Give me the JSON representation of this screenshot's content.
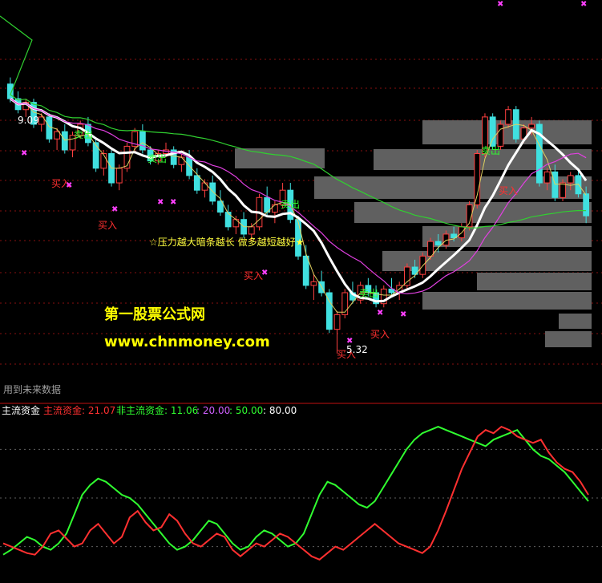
{
  "main": {
    "high_label": "9.09",
    "low_label": "5.32",
    "top_hint": "用到未来数据",
    "signals": [
      {
        "text": "卖出",
        "kind": "sell"
      },
      {
        "text": "卖出",
        "kind": "sell"
      },
      {
        "text": "卖出",
        "kind": "sell"
      },
      {
        "text": "卖出",
        "kind": "sell"
      },
      {
        "text": "卖出",
        "kind": "sell"
      },
      {
        "text": "买入",
        "kind": "buy"
      },
      {
        "text": "买入",
        "kind": "buy"
      },
      {
        "text": "买入",
        "kind": "buy"
      },
      {
        "text": "买入",
        "kind": "buy"
      },
      {
        "text": "买入",
        "kind": "buy"
      },
      {
        "text": "买入",
        "kind": "buy"
      }
    ],
    "annotation": "☆压力越大暗条越长 做多越短越好★",
    "watermark_cn": "第一股票公式网",
    "watermark_url": "www.chnmoney.com"
  },
  "sub": {
    "title": "主流资金",
    "legend": [
      {
        "text": "主流资金: 21.07",
        "color": "#ff3030"
      },
      {
        "text": "非主流资金: 11.06",
        "color": "#30ff30"
      },
      {
        "text": ": 20.00",
        "color": "#d060ff"
      },
      {
        "text": ": 50.00",
        "color": "#30ff30"
      },
      {
        "text": ": 80.00",
        "color": "#ffffff"
      }
    ]
  },
  "colors": {
    "up": "#ff4040",
    "down": "#40e0e0",
    "ma_white": "#ffffff",
    "ma_magenta": "#e040e0",
    "ma_green": "#30d030",
    "ma_yellow": "#e0d060",
    "grid": "#8a1010",
    "bar": "#606060",
    "watermark": "#ffff00"
  },
  "chart_data": {
    "type": "candlestick+line",
    "candles": [
      [
        9.0,
        9.09,
        8.75,
        8.8
      ],
      [
        8.8,
        8.9,
        8.6,
        8.65
      ],
      [
        8.65,
        8.8,
        8.55,
        8.75
      ],
      [
        8.75,
        8.8,
        8.4,
        8.45
      ],
      [
        8.45,
        8.6,
        8.35,
        8.55
      ],
      [
        8.55,
        8.6,
        8.2,
        8.25
      ],
      [
        8.25,
        8.4,
        8.1,
        8.35
      ],
      [
        8.35,
        8.45,
        8.05,
        8.1
      ],
      [
        8.1,
        8.35,
        8.0,
        8.3
      ],
      [
        8.3,
        8.5,
        8.25,
        8.45
      ],
      [
        8.45,
        8.55,
        8.15,
        8.2
      ],
      [
        8.2,
        8.25,
        7.8,
        7.85
      ],
      [
        7.85,
        8.1,
        7.75,
        8.05
      ],
      [
        8.05,
        8.1,
        7.6,
        7.65
      ],
      [
        7.65,
        7.9,
        7.55,
        7.85
      ],
      [
        7.85,
        8.2,
        7.8,
        8.15
      ],
      [
        8.15,
        8.4,
        8.1,
        8.35
      ],
      [
        8.35,
        8.45,
        8.05,
        8.1
      ],
      [
        8.1,
        8.15,
        7.9,
        7.95
      ],
      [
        7.95,
        8.1,
        7.9,
        8.05
      ],
      [
        8.05,
        8.2,
        8.0,
        8.1
      ],
      [
        8.1,
        8.15,
        7.85,
        7.9
      ],
      [
        7.9,
        8.05,
        7.8,
        8.0
      ],
      [
        8.0,
        8.1,
        7.7,
        7.75
      ],
      [
        7.75,
        7.85,
        7.5,
        7.55
      ],
      [
        7.55,
        7.7,
        7.45,
        7.65
      ],
      [
        7.65,
        7.75,
        7.35,
        7.4
      ],
      [
        7.4,
        7.55,
        7.2,
        7.25
      ],
      [
        7.25,
        7.35,
        7.0,
        7.05
      ],
      [
        7.05,
        7.2,
        6.95,
        7.15
      ],
      [
        7.15,
        7.25,
        6.9,
        6.95
      ],
      [
        6.95,
        7.1,
        6.85,
        7.05
      ],
      [
        7.05,
        7.5,
        7.0,
        7.45
      ],
      [
        7.45,
        7.6,
        7.2,
        7.25
      ],
      [
        7.25,
        7.4,
        7.1,
        7.35
      ],
      [
        7.35,
        7.65,
        7.3,
        7.55
      ],
      [
        7.55,
        7.65,
        7.1,
        7.15
      ],
      [
        7.15,
        7.2,
        6.6,
        6.65
      ],
      [
        6.65,
        6.8,
        6.2,
        6.25
      ],
      [
        6.25,
        6.4,
        6.05,
        6.3
      ],
      [
        6.3,
        6.45,
        6.1,
        6.15
      ],
      [
        6.15,
        6.2,
        5.6,
        5.65
      ],
      [
        5.65,
        5.9,
        5.32,
        5.85
      ],
      [
        5.85,
        6.2,
        5.8,
        6.15
      ],
      [
        6.15,
        6.3,
        6.0,
        6.05
      ],
      [
        6.05,
        6.3,
        6.0,
        6.25
      ],
      [
        6.25,
        6.35,
        6.1,
        6.15
      ],
      [
        6.15,
        6.25,
        5.95,
        6.0
      ],
      [
        6.0,
        6.25,
        5.95,
        6.2
      ],
      [
        6.2,
        6.35,
        6.1,
        6.15
      ],
      [
        6.15,
        6.3,
        6.05,
        6.25
      ],
      [
        6.25,
        6.55,
        6.2,
        6.5
      ],
      [
        6.5,
        6.6,
        6.35,
        6.4
      ],
      [
        6.4,
        6.7,
        6.35,
        6.65
      ],
      [
        6.65,
        6.9,
        6.6,
        6.85
      ],
      [
        6.85,
        6.95,
        6.7,
        6.8
      ],
      [
        6.8,
        7.0,
        6.75,
        6.95
      ],
      [
        6.95,
        7.05,
        6.85,
        6.9
      ],
      [
        6.9,
        7.1,
        6.85,
        7.05
      ],
      [
        7.05,
        7.4,
        7.0,
        7.35
      ],
      [
        7.35,
        8.1,
        7.3,
        8.05
      ],
      [
        8.05,
        8.6,
        8.0,
        8.55
      ],
      [
        8.55,
        8.6,
        8.1,
        8.15
      ],
      [
        8.15,
        8.5,
        8.1,
        8.45
      ],
      [
        8.45,
        8.7,
        8.4,
        8.65
      ],
      [
        8.65,
        8.7,
        8.2,
        8.25
      ],
      [
        8.25,
        8.45,
        8.2,
        8.4
      ],
      [
        8.4,
        8.55,
        8.3,
        8.45
      ],
      [
        8.45,
        8.5,
        7.6,
        7.65
      ],
      [
        7.65,
        7.85,
        7.55,
        7.8
      ],
      [
        7.8,
        7.9,
        7.4,
        7.45
      ],
      [
        7.45,
        7.7,
        7.4,
        7.65
      ],
      [
        7.65,
        7.8,
        7.55,
        7.75
      ],
      [
        7.75,
        7.85,
        7.45,
        7.5
      ],
      [
        7.5,
        7.6,
        7.1,
        7.2
      ]
    ],
    "mfi_main": [
      22,
      20,
      18,
      16,
      15,
      20,
      28,
      30,
      25,
      20,
      22,
      30,
      34,
      28,
      22,
      26,
      38,
      42,
      35,
      30,
      32,
      40,
      36,
      28,
      22,
      20,
      24,
      28,
      26,
      18,
      14,
      18,
      22,
      20,
      24,
      28,
      26,
      22,
      18,
      14,
      12,
      16,
      20,
      18,
      22,
      26,
      30,
      34,
      30,
      26,
      22,
      20,
      18,
      16,
      20,
      30,
      42,
      55,
      68,
      78,
      88,
      92,
      90,
      94,
      92,
      88,
      86,
      84,
      86,
      78,
      72,
      68,
      66,
      60,
      52
    ],
    "mfi_other": [
      15,
      18,
      22,
      26,
      24,
      20,
      18,
      22,
      28,
      40,
      52,
      58,
      62,
      60,
      56,
      52,
      50,
      46,
      40,
      34,
      28,
      22,
      18,
      20,
      24,
      30,
      36,
      34,
      28,
      22,
      18,
      20,
      26,
      30,
      28,
      24,
      20,
      22,
      28,
      40,
      52,
      60,
      58,
      54,
      50,
      46,
      44,
      48,
      56,
      64,
      72,
      80,
      86,
      90,
      92,
      94,
      92,
      90,
      88,
      86,
      84,
      82,
      86,
      88,
      90,
      92,
      86,
      80,
      76,
      74,
      70,
      66,
      60,
      54,
      48
    ]
  }
}
